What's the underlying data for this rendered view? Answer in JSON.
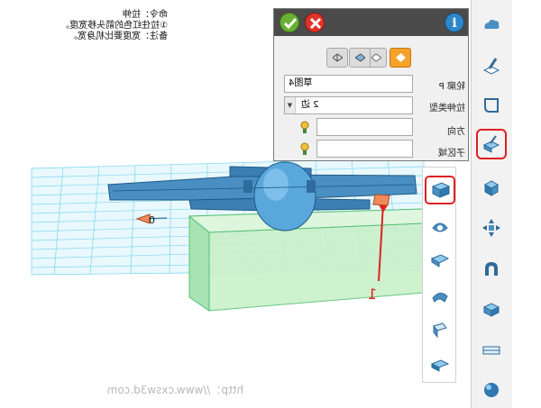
{
  "instruction": {
    "line1": "命令：拉伸",
    "line2": "①拉住红色的箭头移宽度。",
    "line3": "备注：宽度要比机身宽。"
  },
  "watermark": "http：//www.cxsw3d.com",
  "panel": {
    "buttons": {
      "ok_icon": "check-icon",
      "cancel_icon": "close-icon",
      "info_label": "i"
    },
    "modes": [
      "extrude-mode-icon",
      "revolve-mode-icon",
      "sweep-mode-icon",
      "loft-mode-icon"
    ],
    "active_mode_index": 0,
    "rows": [
      {
        "label": "轮廓 P",
        "value": "草图4"
      },
      {
        "label": "拉伸类型",
        "value": "2 边"
      },
      {
        "label": "方向",
        "value": ""
      },
      {
        "label": "子区域",
        "value": ""
      }
    ]
  },
  "viewport": {
    "dimension_label": "0",
    "arrow_number": "1"
  },
  "right_toolbar": {
    "items": [
      "cloud-icon",
      "sketch-icon",
      "curve-icon",
      "feature-icon",
      "solid-icon",
      "transform-icon",
      "magnet-icon",
      "assembly-icon",
      "measure-icon",
      "render-icon"
    ],
    "selected_index": 3
  },
  "sub_toolbar": {
    "items": [
      "extrude-icon",
      "revolve-icon",
      "sweep-icon",
      "loft-icon",
      "fillet-icon",
      "shell-icon"
    ],
    "selected_index": 0
  },
  "colors": {
    "model_blue": "#4a8fc2",
    "grid_cyan": "#6fd3f0",
    "box_green": "#c9f0c9",
    "arrow_red": "#e02020",
    "active_mode": "#f5a12a"
  }
}
